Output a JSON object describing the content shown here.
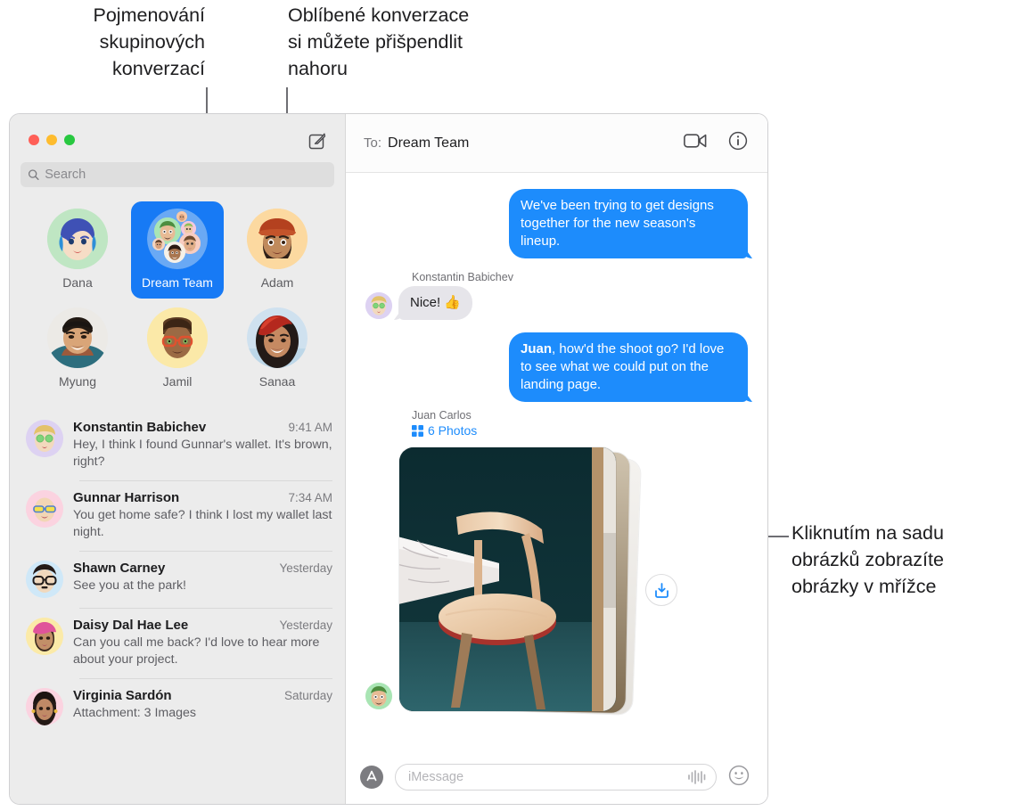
{
  "annotations": [
    {
      "id": "group-naming",
      "text": "Pojmenování\nskupinových\nkonverzací"
    },
    {
      "id": "pin-top",
      "text": "Oblíbené konverzace\nsi můžete přišpendlit\nnahoru"
    },
    {
      "id": "photo-grid",
      "text": "Kliknutím na sadu\nobrázků zobrazíte\nobrázky v mřížce"
    }
  ],
  "window": {
    "titlebar": {
      "close_label": "close",
      "minimize_label": "minimize",
      "maximize_label": "maximize",
      "compose_icon": "compose-pencil-square-icon"
    },
    "search": {
      "placeholder": "Search",
      "value": "",
      "icon": "search-icon"
    }
  },
  "sidebar": {
    "pinned": [
      {
        "name": "Dana",
        "selected": false,
        "avatar": "memoji-blue-hair",
        "bg": "#bfe6c3"
      },
      {
        "name": "Dream Team",
        "selected": true,
        "avatar": "group-cluster",
        "bg": "#177af5"
      },
      {
        "name": "Adam",
        "selected": false,
        "avatar": "memoji-orange-cap",
        "bg": "#fcd9a0"
      },
      {
        "name": "Myung",
        "selected": false,
        "avatar": "photo-myung",
        "bg": "#e8e8e6"
      },
      {
        "name": "Jamil",
        "selected": false,
        "avatar": "memoji-glasses",
        "bg": "#fbe9a8"
      },
      {
        "name": "Sanaa",
        "selected": false,
        "avatar": "photo-sanaa",
        "bg": "#dfe9f2"
      }
    ],
    "conversations": [
      {
        "name": "Konstantin Babichev",
        "time": "9:41 AM",
        "preview": "Hey, I think I found Gunnar's wallet. It's brown, right?",
        "avatar_bg": "#ddd2f2"
      },
      {
        "name": "Gunnar Harrison",
        "time": "7:34 AM",
        "preview": "You get home safe? I think I lost my wallet last night.",
        "avatar_bg": "#fbd3e0"
      },
      {
        "name": "Shawn Carney",
        "time": "Yesterday",
        "preview": "See you at the park!",
        "avatar_bg": "#cfe8f8"
      },
      {
        "name": "Daisy Dal Hae Lee",
        "time": "Yesterday",
        "preview": "Can you call me back? I'd love to hear more about your project.",
        "avatar_bg": "#fbeaa8"
      },
      {
        "name": "Virginia Sardón",
        "time": "Saturday",
        "preview": "Attachment: 3 Images",
        "avatar_bg": "#fbd3e0"
      }
    ]
  },
  "chat": {
    "header": {
      "to_label": "To:",
      "recipient": "Dream Team",
      "facetime_icon": "video-camera-icon",
      "info_icon": "info-circle-icon"
    },
    "messages": [
      {
        "direction": "out",
        "text": "We've been trying to get designs together for the new season's lineup."
      },
      {
        "direction": "in",
        "sender": "Konstantin Babichev",
        "text": "Nice! 👍",
        "avatar_bg": "#ddd2f2"
      },
      {
        "direction": "out",
        "text_bold": "Juan",
        "text": ", how'd the shoot go? I'd love to see what we could put on the landing page."
      }
    ],
    "attachment": {
      "sender": "Juan Carlos",
      "count_label": "6 Photos",
      "grid_icon": "photo-grid-icon",
      "save_icon": "download-save-icon",
      "avatar_bg": "#bfe6c3"
    },
    "composer": {
      "appstore_icon": "app-store-icon",
      "placeholder": "iMessage",
      "value": "",
      "audio_icon": "audio-waveform-icon",
      "emoji_icon": "emoji-smiley-icon"
    }
  },
  "colors": {
    "accent_blue": "#1d8cfc",
    "selected_blue": "#177af5",
    "bubble_gray": "#e6e5ea",
    "sidebar_bg": "#ececec"
  }
}
